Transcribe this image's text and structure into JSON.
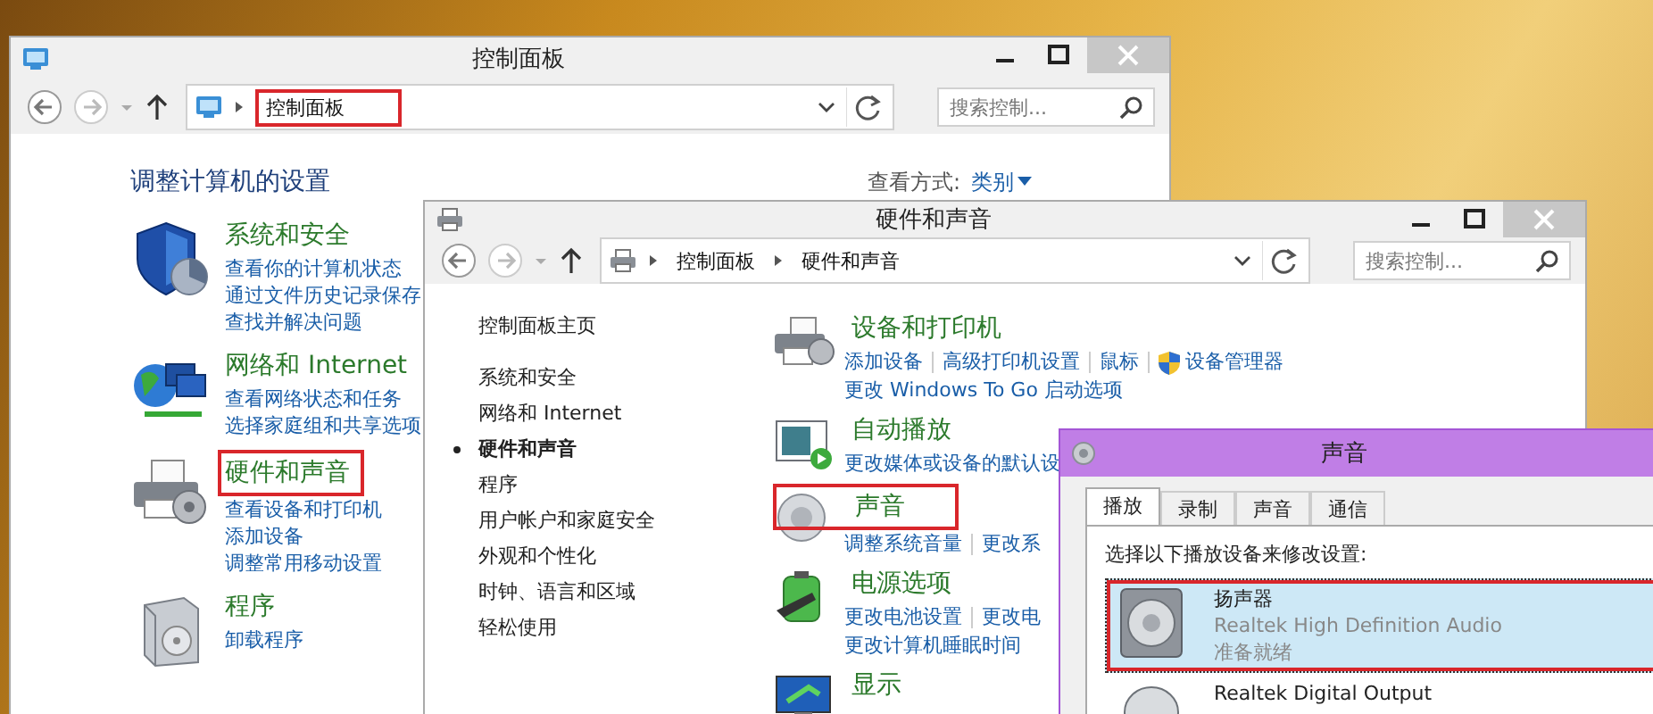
{
  "control_panel_window": {
    "title": "控制面板",
    "address": {
      "crumbs": [
        {
          "label": "控制面板",
          "highlighted": true
        }
      ]
    },
    "search": {
      "placeholder": "搜索控制..."
    },
    "heading": "调整计算机的设置",
    "view_by": {
      "label": "查看方式:",
      "value": "类别"
    },
    "categories": [
      {
        "title": "系统和安全",
        "highlighted": false,
        "links": [
          "查看你的计算机状态",
          "通过文件历史记录保存",
          "查找并解决问题"
        ]
      },
      {
        "title": "网络和 Internet",
        "highlighted": false,
        "links": [
          "查看网络状态和任务",
          "选择家庭组和共享选项"
        ]
      },
      {
        "title": "硬件和声音",
        "highlighted": true,
        "links": [
          "查看设备和打印机",
          "添加设备",
          "调整常用移动设置"
        ]
      },
      {
        "title": "程序",
        "highlighted": false,
        "links": [
          "卸载程序"
        ]
      }
    ]
  },
  "hardware_window": {
    "title": "硬件和声音",
    "address": {
      "crumbs": [
        {
          "label": "控制面板",
          "highlighted": false
        },
        {
          "label": "硬件和声音",
          "highlighted": false
        }
      ]
    },
    "search": {
      "placeholder": "搜索控制..."
    },
    "nav": [
      {
        "label": "控制面板主页",
        "selected": false
      },
      {
        "label": "系统和安全",
        "selected": false
      },
      {
        "label": "网络和 Internet",
        "selected": false
      },
      {
        "label": "硬件和声音",
        "selected": true
      },
      {
        "label": "程序",
        "selected": false
      },
      {
        "label": "用户帐户和家庭安全",
        "selected": false
      },
      {
        "label": "外观和个性化",
        "selected": false
      },
      {
        "label": "时钟、语言和区域",
        "selected": false
      },
      {
        "label": "轻松使用",
        "selected": false
      }
    ],
    "sections": [
      {
        "title": "设备和打印机",
        "highlighted": false,
        "link_rows": [
          [
            {
              "text": "添加设备",
              "shield": false
            },
            {
              "text": "高级打印机设置",
              "shield": false
            },
            {
              "text": "鼠标",
              "shield": false
            },
            {
              "text": "设备管理器",
              "shield": true
            }
          ],
          [
            {
              "text": "更改 Windows To Go 启动选项",
              "shield": false
            }
          ]
        ]
      },
      {
        "title": "自动播放",
        "highlighted": false,
        "link_rows": [
          [
            {
              "text": "更改媒体或设备的默认设",
              "shield": false
            }
          ]
        ]
      },
      {
        "title": "声音",
        "highlighted": true,
        "link_rows": [
          [
            {
              "text": "调整系统音量",
              "shield": false
            },
            {
              "text": "更改系",
              "shield": false
            }
          ]
        ]
      },
      {
        "title": "电源选项",
        "highlighted": false,
        "link_rows": [
          [
            {
              "text": "更改电池设置",
              "shield": false
            },
            {
              "text": "更改电",
              "shield": false
            }
          ],
          [
            {
              "text": "更改计算机睡眠时间",
              "shield": false
            }
          ]
        ]
      },
      {
        "title": "显示",
        "highlighted": false
      }
    ]
  },
  "sound_dialog": {
    "title": "声音",
    "tabs": [
      {
        "label": "播放",
        "selected": true
      },
      {
        "label": "录制",
        "selected": false
      },
      {
        "label": "声音",
        "selected": false
      },
      {
        "label": "通信",
        "selected": false
      }
    ],
    "instruction": "选择以下播放设备来修改设置:",
    "devices": [
      {
        "name": "扬声器",
        "driver": "Realtek High Definition Audio",
        "status": "准备就绪",
        "selected": true,
        "highlighted": true
      },
      {
        "name": "Realtek Digital Output",
        "selected": false,
        "highlighted": false
      }
    ]
  }
}
